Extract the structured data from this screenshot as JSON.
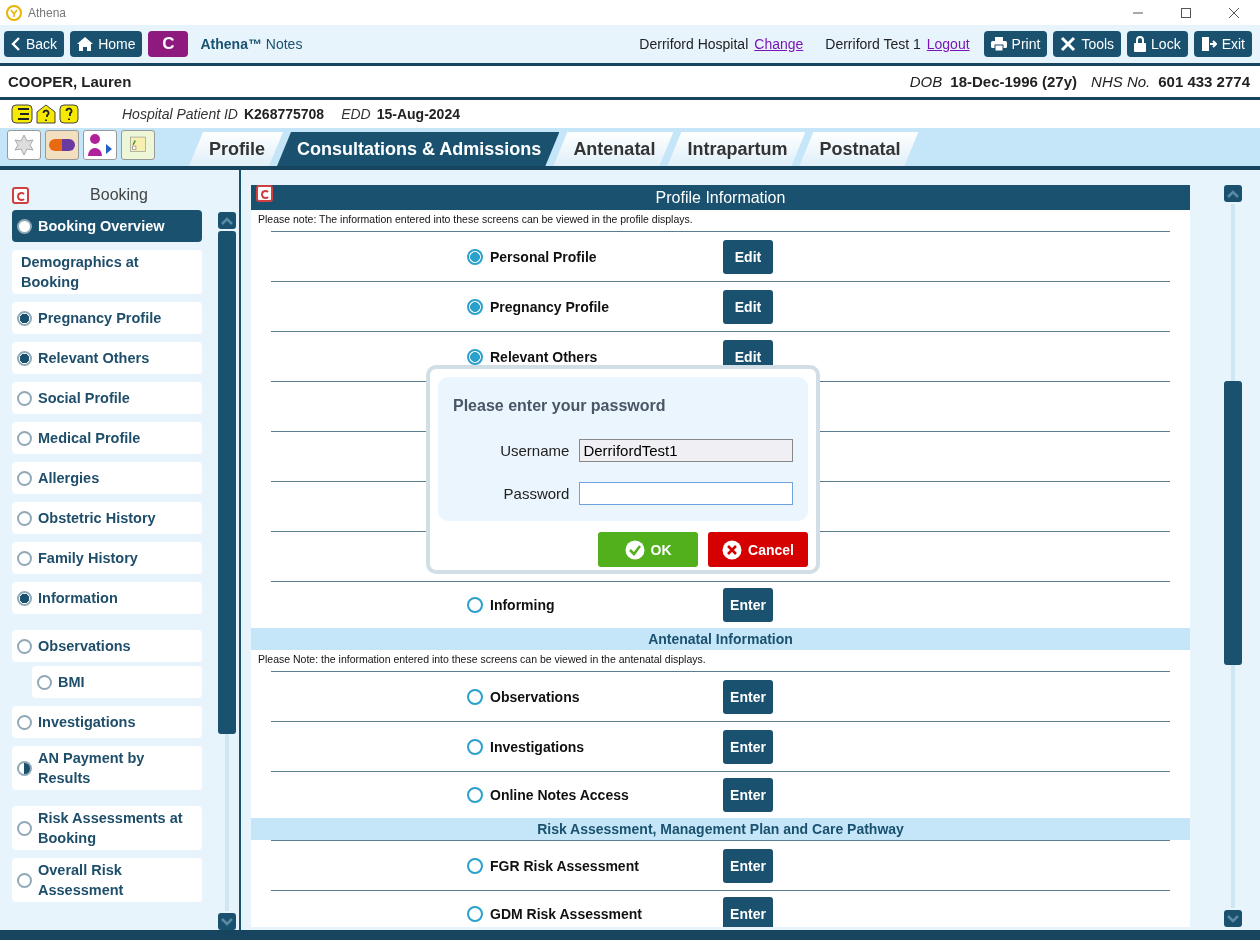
{
  "window": {
    "title": "Athena"
  },
  "toolbar": {
    "back": "Back",
    "home": "Home",
    "app_badge": "C",
    "app_name": "Athena™",
    "app_sub": "Notes",
    "hospital": "Derriford Hospital",
    "change_link": "Change",
    "user": "Derriford Test 1",
    "logout_link": "Logout",
    "buttons": [
      {
        "kind": "print",
        "label": "Print"
      },
      {
        "kind": "tools",
        "label": "Tools"
      },
      {
        "kind": "lock",
        "label": "Lock"
      },
      {
        "kind": "exit",
        "label": "Exit"
      }
    ]
  },
  "patient": {
    "name": "COOPER, Lauren",
    "dob_label": "DOB",
    "dob": "18-Dec-1996 (27y)",
    "nhs_label": "NHS No.",
    "nhs": "601 433 2774",
    "id_label": "Hospital Patient ID",
    "id": "K268775708",
    "edd_label": "EDD",
    "edd": "15-Aug-2024"
  },
  "tabs": [
    {
      "label": "Profile",
      "selected": false
    },
    {
      "label": "Consultations & Admissions",
      "selected": true
    },
    {
      "label": "Antenatal",
      "selected": false
    },
    {
      "label": "Intrapartum",
      "selected": false
    },
    {
      "label": "Postnatal",
      "selected": false
    }
  ],
  "sidebar": {
    "title": "Booking",
    "items": [
      {
        "label": "Booking Overview",
        "kind": "empty",
        "selected": true
      },
      {
        "label": "Demographics at Booking",
        "kind": "plain",
        "selected": false
      },
      {
        "label": "Pregnancy Profile",
        "kind": "filled",
        "selected": false
      },
      {
        "label": "Relevant Others",
        "kind": "filled",
        "selected": false
      },
      {
        "label": "Social Profile",
        "kind": "empty",
        "selected": false
      },
      {
        "label": "Medical Profile",
        "kind": "empty",
        "selected": false
      },
      {
        "label": "Allergies",
        "kind": "empty",
        "selected": false
      },
      {
        "label": "Obstetric History",
        "kind": "empty",
        "selected": false
      },
      {
        "label": "Family History",
        "kind": "empty",
        "selected": false
      },
      {
        "label": "Information",
        "kind": "filled",
        "selected": false
      },
      {
        "label": "Observations",
        "kind": "empty",
        "selected": false,
        "children": [
          {
            "label": "BMI",
            "kind": "empty",
            "selected": false
          }
        ]
      },
      {
        "label": "Investigations",
        "kind": "empty",
        "selected": false
      },
      {
        "label": "AN Payment by Results",
        "kind": "half",
        "selected": false
      },
      {
        "label": "Risk Assessments at Booking",
        "kind": "empty",
        "selected": false
      },
      {
        "label": "Overall Risk Assessment",
        "kind": "empty",
        "selected": false
      }
    ]
  },
  "content": {
    "sections": [
      {
        "kind": "header",
        "title": "Profile Information",
        "note": "Please note: The information entered into these screens can be viewed in the profile displays.",
        "rows": [
          {
            "label": "Personal Profile",
            "checked": true,
            "button": "Edit"
          },
          {
            "label": "Pregnancy Profile",
            "checked": true,
            "button": "Edit"
          },
          {
            "label": "Relevant Others",
            "checked": true,
            "button": "Edit"
          },
          {
            "label": "Informing",
            "checked": false,
            "button": "Enter"
          }
        ]
      },
      {
        "kind": "band",
        "title": "Antenatal Information",
        "note": "Please Note: the information entered into these screens can be viewed in the antenatal displays.",
        "rows": [
          {
            "label": "Observations",
            "checked": false,
            "button": "Enter"
          },
          {
            "label": "Investigations",
            "checked": false,
            "button": "Enter"
          },
          {
            "label": "Online Notes Access",
            "checked": false,
            "button": "Enter"
          }
        ]
      },
      {
        "kind": "band",
        "title": "Risk Assessment, Management Plan and Care Pathway",
        "rows": [
          {
            "label": "FGR Risk Assessment",
            "checked": false,
            "button": "Enter"
          },
          {
            "label": "GDM Risk Assessment",
            "checked": false,
            "button": "Enter"
          }
        ]
      }
    ]
  },
  "dialog": {
    "title": "Please enter your password",
    "username_label": "Username",
    "username": "DerrifordTest1",
    "password_label": "Password",
    "ok": "OK",
    "cancel": "Cancel"
  }
}
